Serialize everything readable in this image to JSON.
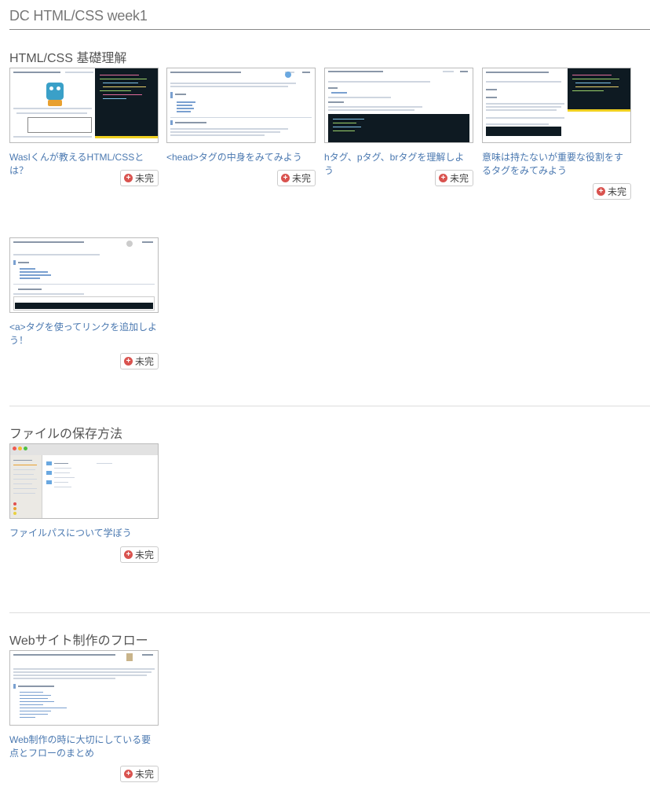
{
  "page": {
    "title": "DC HTML/CSS week1"
  },
  "status_label": "未完",
  "colors": {
    "link": "#4a78b0",
    "badge_icon": "#d9534f",
    "code_bg": "#0e1a22"
  },
  "sections": [
    {
      "title": "HTML/CSS 基礎理解",
      "cards": [
        {
          "title": "WasIくんが教えるHTML/CSSとは？",
          "thumb_title": "WasIくんが教えるHTML/CSSとは？"
        },
        {
          "title": "<head>タグの中身をみてみよう",
          "thumb_title": "<head>タグの中身をみてみよう"
        },
        {
          "title": "hタグ、pタグ、brタグを理解しよう",
          "thumb_title": "hタグ、pタグ、brタグを理解しよう"
        },
        {
          "title": "意味は持たないが重要な役割をするタグをみてみよう",
          "thumb_title": "意味は持たないが重要な役割をするタグをみてみよう"
        },
        {
          "title": "<a>タグを使ってリンクを追加しよう！",
          "thumb_title": "<a>タグを使ってリンクを追加しよう！"
        }
      ]
    },
    {
      "title": "ファイルの保存方法",
      "cards": [
        {
          "title": "ファイルパスについて学ぼう"
        }
      ]
    },
    {
      "title": "Webサイト制作のフロー",
      "cards": [
        {
          "title": "Web制作の時に大切にしている要点とフローのまとめ",
          "thumb_title": "Web制作の時に大切にしている要点とフローのまとめ"
        }
      ]
    }
  ]
}
